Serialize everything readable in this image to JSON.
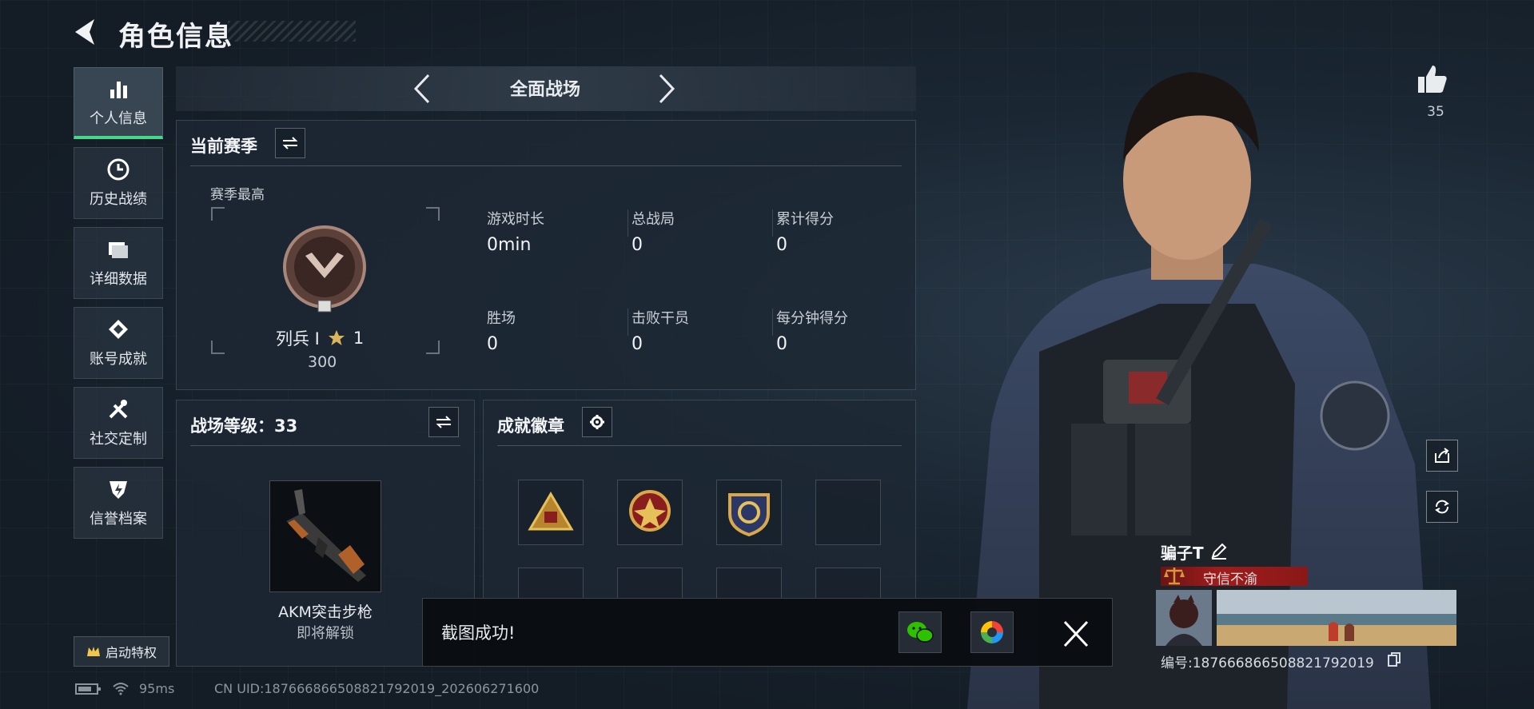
{
  "header": {
    "title": "角色信息"
  },
  "sidebar": {
    "items": [
      {
        "label": "个人信息",
        "icon": "bar-chart-icon",
        "active": true
      },
      {
        "label": "历史战绩",
        "icon": "clock-icon",
        "active": false
      },
      {
        "label": "详细数据",
        "icon": "folder-icon",
        "active": false
      },
      {
        "label": "账号成就",
        "icon": "achievement-icon",
        "active": false
      },
      {
        "label": "社交定制",
        "icon": "tools-icon",
        "active": false
      },
      {
        "label": "信誉档案",
        "icon": "shield-bolt-icon",
        "active": false
      }
    ],
    "perk_label": "启动特权"
  },
  "mode": {
    "label": "全面战场"
  },
  "season": {
    "title": "当前赛季",
    "best_label": "赛季最高",
    "rank_name": "列兵 I",
    "stars": "1",
    "points": "300",
    "stats": [
      {
        "label": "游戏时长",
        "value": "0min"
      },
      {
        "label": "总战局",
        "value": "0"
      },
      {
        "label": "累计得分",
        "value": "0"
      },
      {
        "label": "胜场",
        "value": "0"
      },
      {
        "label": "击败干员",
        "value": "0"
      },
      {
        "label": "每分钟得分",
        "value": "0"
      }
    ]
  },
  "level": {
    "title": "战场等级：33",
    "weapon_name": "AKM突击步枪",
    "weapon_status": "即将解锁"
  },
  "badges": {
    "title": "成就徽章"
  },
  "toast": {
    "text": "截图成功!"
  },
  "status_bar": {
    "ping": "95ms",
    "uid": "CN UID:18766686650882179​2019_202606271600"
  },
  "profile": {
    "likes": "35",
    "name": "骗子T",
    "motto": "守信不渝",
    "id": "编号:18766686650882179​2019"
  },
  "colors": {
    "accent": "#43d88c",
    "motto_bar": "#a01c1c",
    "wechat": "#2dc100"
  }
}
